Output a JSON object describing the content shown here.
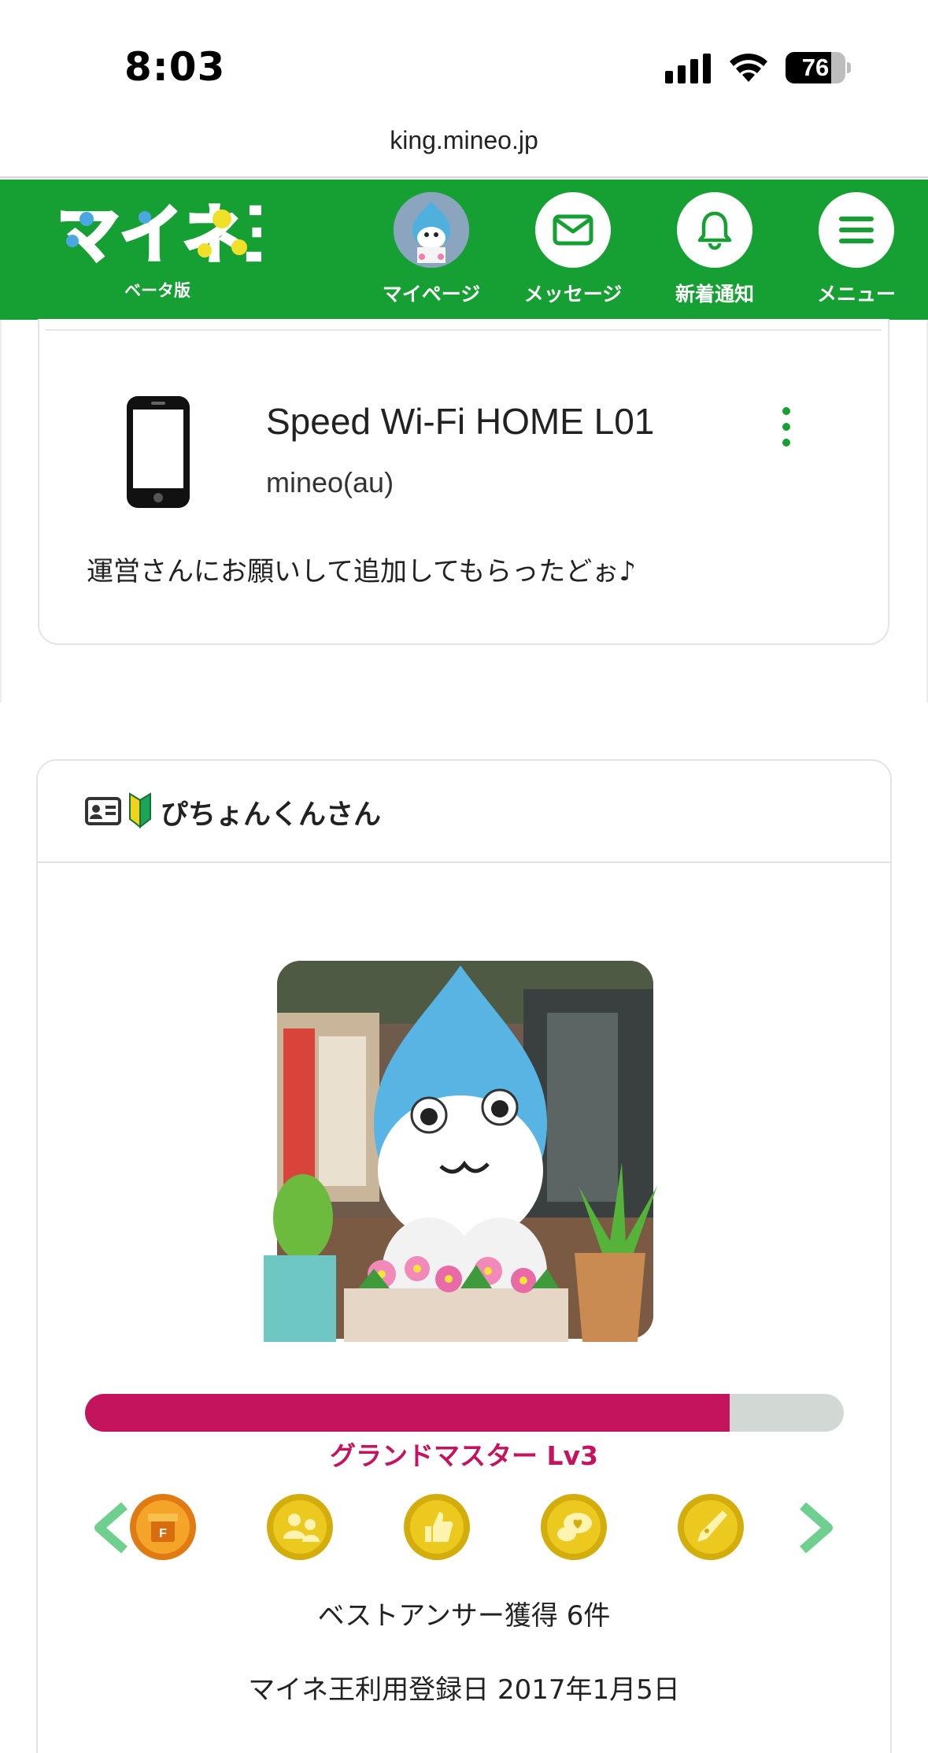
{
  "status_bar": {
    "time": "8:03",
    "battery_percent": "76",
    "battery_level": 0.76,
    "url": "king.mineo.jp"
  },
  "header": {
    "logo_text": "マイネ王",
    "logo_sub": "ベータ版",
    "nav": [
      {
        "label": "マイページ",
        "icon": "avatar"
      },
      {
        "label": "メッセージ",
        "icon": "envelope-icon"
      },
      {
        "label": "新着通知",
        "icon": "bell-icon"
      },
      {
        "label": "メニュー",
        "icon": "hamburger-icon"
      }
    ]
  },
  "device": {
    "name": "Speed Wi-Fi HOME L01",
    "carrier": "mineo(au)",
    "comment": "運営さんにお願いして追加してもらったどぉ♪"
  },
  "profile": {
    "name": "ぴちょんくんさん",
    "progress": 0.85,
    "rank": "グランドマスター Lv3",
    "best_answer": "ベストアンサー獲得 6件",
    "registered": "マイネ王利用登録日 2017年1月5日"
  },
  "colors": {
    "brand_green": "#16a033",
    "rank_magenta": "#c4145e",
    "badge_gold": "#e2be16"
  },
  "badges": [
    "gift-badge-icon",
    "people-badge-icon",
    "thumbs-up-badge-icon",
    "chat-heart-badge-icon",
    "pen-badge-icon"
  ]
}
